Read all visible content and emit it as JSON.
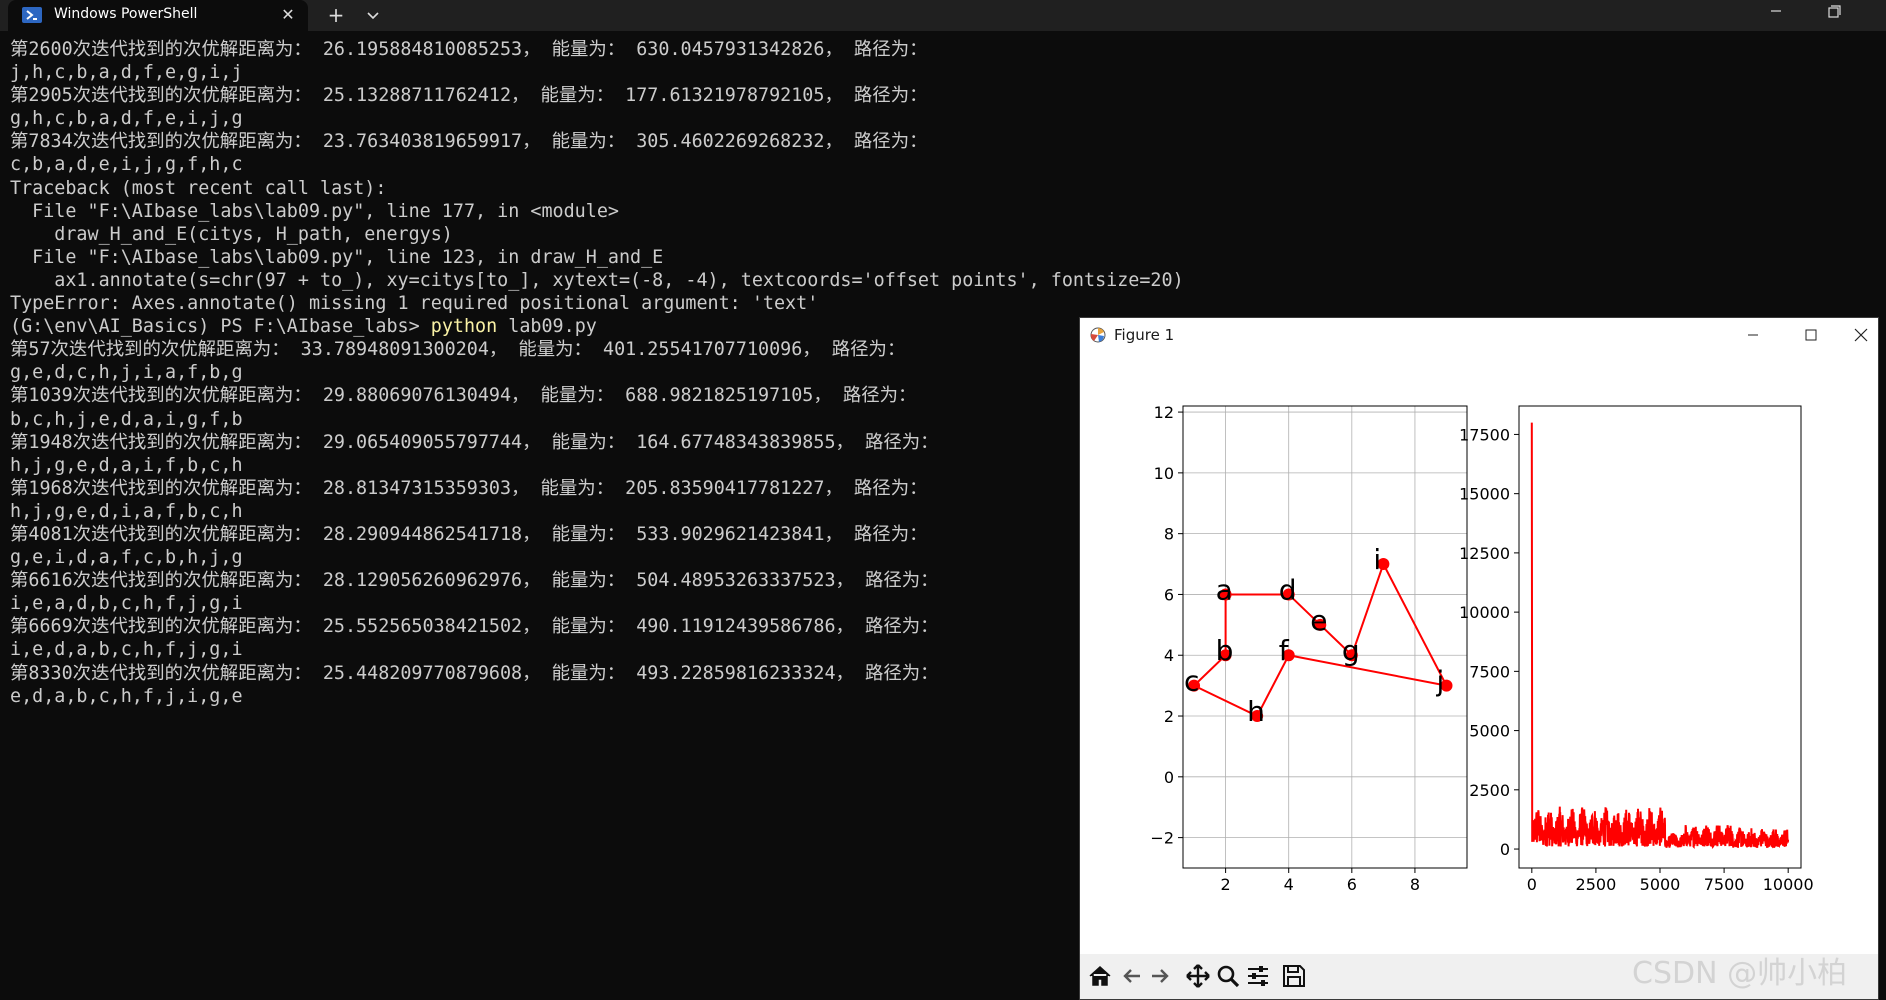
{
  "tabbar": {
    "tab_title": "Windows PowerShell",
    "close_glyph": "✕",
    "new_tab_glyph": "+",
    "icon": "powershell-icon"
  },
  "console": {
    "lines": [
      "第2600次迭代找到的次优解距离为： 26.195884810085253， 能量为： 630.0457931342826， 路径为：",
      "j,h,c,b,a,d,f,e,g,i,j",
      "第2905次迭代找到的次优解距离为： 25.13288711762412， 能量为： 177.61321978792105， 路径为：",
      "g,h,c,b,a,d,f,e,i,j,g",
      "第7834次迭代找到的次优解距离为： 23.763403819659917， 能量为： 305.4602269268232， 路径为：",
      "c,b,a,d,e,i,j,g,f,h,c",
      "Traceback (most recent call last):",
      "  File \"F:\\AIbase_labs\\lab09.py\", line 177, in <module>",
      "    draw_H_and_E(citys, H_path, energys)",
      "  File \"F:\\AIbase_labs\\lab09.py\", line 123, in draw_H_and_E",
      "    ax1.annotate(s=chr(97 + to_), xy=citys[to_], xytext=(-8, -4), textcoords='offset points', fontsize=20)",
      "TypeError: Axes.annotate() missing 1 required positional argument: 'text'",
      "第57次迭代找到的次优解距离为： 33.78948091300204， 能量为： 401.25541707710096， 路径为：",
      "g,e,d,c,h,j,i,a,f,b,g",
      "第1039次迭代找到的次优解距离为： 29.88069076130494， 能量为： 688.9821825197105， 路径为：",
      "b,c,h,j,e,d,a,i,g,f,b",
      "第1948次迭代找到的次优解距离为： 29.065409055797744， 能量为： 164.67748343839855， 路径为：",
      "h,j,g,e,d,a,i,f,b,c,h",
      "第1968次迭代找到的次优解距离为： 28.81347315359303， 能量为： 205.83590417781227， 路径为：",
      "h,j,g,e,d,i,a,f,b,c,h",
      "第4081次迭代找到的次优解距离为： 28.290944862541718， 能量为： 533.9029621423841， 路径为：",
      "g,e,i,d,a,f,c,b,h,j,g",
      "第6616次迭代找到的次优解距离为： 28.129056260962976， 能量为： 504.48953263337523， 路径为：",
      "i,e,a,d,b,c,h,f,j,g,i",
      "第6669次迭代找到的次优解距离为： 25.552565038421502， 能量为： 490.11912439586786， 路径为：",
      "i,e,d,a,b,c,h,f,j,g,i",
      "第8330次迭代找到的次优解距离为： 25.448209770879608， 能量为： 493.22859816233324， 路径为：",
      "e,d,a,b,c,h,f,j,i,g,e"
    ],
    "prompt": {
      "prefix": "(G:\\env\\AI_Basics) PS F:\\AIbase_labs> ",
      "command": "python",
      "args": " lab09.py"
    },
    "text_color": "#cccccc",
    "command_color": "#f9f1a5"
  },
  "figure": {
    "title": "Figure 1",
    "toolbar": [
      "home-icon",
      "back-arrow-icon",
      "forward-arrow-icon",
      "pan-icon",
      "zoom-icon",
      "configure-subplots-icon",
      "save-icon"
    ]
  },
  "chart_data": [
    {
      "type": "line",
      "color": "#ff0000",
      "markers": true,
      "grid": true,
      "xlim": [
        0.65,
        9.65
      ],
      "ylim": [
        -3,
        12.2
      ],
      "xticks": [
        2,
        4,
        6,
        8
      ],
      "yticks": [
        -2,
        0,
        2,
        4,
        6,
        8,
        10,
        12
      ],
      "path": [
        "e",
        "d",
        "a",
        "b",
        "c",
        "h",
        "f",
        "j",
        "i",
        "g",
        "e"
      ],
      "points": [
        {
          "label": "a",
          "x": 2,
          "y": 6
        },
        {
          "label": "b",
          "x": 2,
          "y": 4
        },
        {
          "label": "c",
          "x": 1,
          "y": 3
        },
        {
          "label": "d",
          "x": 4,
          "y": 6
        },
        {
          "label": "e",
          "x": 5,
          "y": 5
        },
        {
          "label": "f",
          "x": 4,
          "y": 4
        },
        {
          "label": "g",
          "x": 6,
          "y": 4
        },
        {
          "label": "h",
          "x": 3,
          "y": 2
        },
        {
          "label": "i",
          "x": 7,
          "y": 7
        },
        {
          "label": "j",
          "x": 9,
          "y": 3
        }
      ]
    },
    {
      "type": "line",
      "color": "#ff0000",
      "grid": false,
      "xlim": [
        -500,
        10500
      ],
      "ylim": [
        -800,
        18700
      ],
      "xticks": [
        0,
        2500,
        5000,
        7500,
        10000
      ],
      "yticks": [
        0,
        2500,
        5000,
        7500,
        10000,
        12500,
        15000,
        17500
      ],
      "x_max": 10000,
      "initial_value": 18000,
      "segments": [
        {
          "x_start": 0,
          "x_end": 5200,
          "min": 100,
          "max": 1800
        },
        {
          "x_start": 5200,
          "x_end": 6000,
          "min": 50,
          "max": 700
        },
        {
          "x_start": 6000,
          "x_end": 7800,
          "min": 100,
          "max": 1100
        },
        {
          "x_start": 7800,
          "x_end": 10000,
          "min": 50,
          "max": 900
        }
      ]
    }
  ],
  "watermark": "CSDN @帅小柏"
}
